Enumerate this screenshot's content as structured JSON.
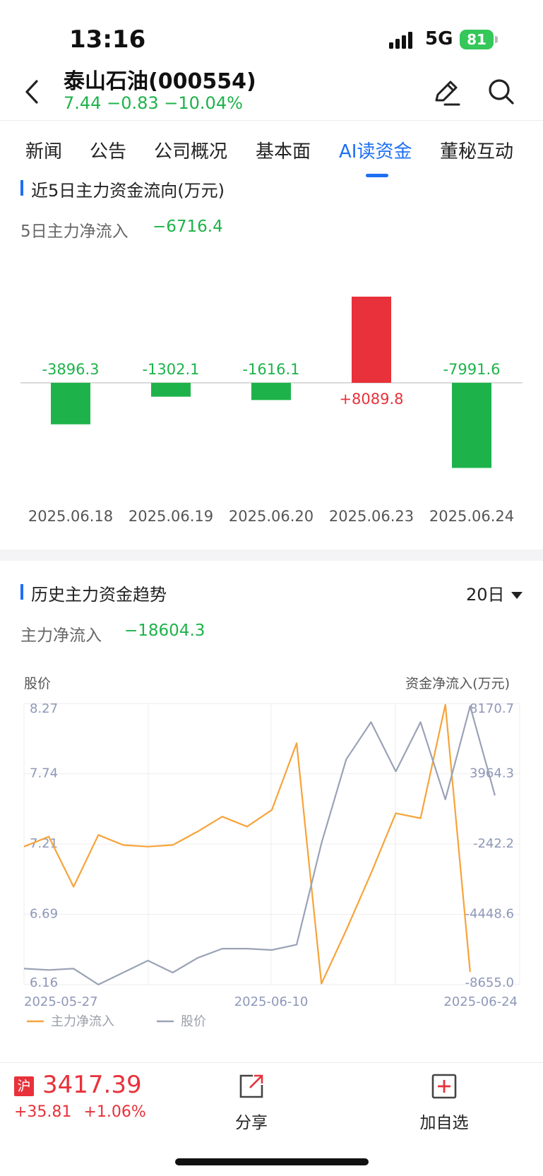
{
  "status_bar": {
    "time": "13:16",
    "network": "5G",
    "battery": "81"
  },
  "header": {
    "title": "泰山石油(000554)",
    "price": "7.44",
    "change": "−0.83",
    "change_pct": "−10.04%"
  },
  "tabs": [
    {
      "label": "新闻"
    },
    {
      "label": "公告"
    },
    {
      "label": "公司概况"
    },
    {
      "label": "基本面"
    },
    {
      "label": "AI读资金",
      "active": true
    },
    {
      "label": "董秘互动"
    }
  ],
  "five_day": {
    "title": "近5日主力资金流向(万元)",
    "net_label": "5日主力净流入",
    "net_value": "−6716.4"
  },
  "history": {
    "title": "历史主力资金趋势",
    "range": "20日",
    "net_label": "主力净流入",
    "net_value": "−18604.3",
    "left_axis_title": "股价",
    "right_axis_title": "资金净流入(万元)"
  },
  "chart_data": [
    {
      "type": "bar",
      "categories": [
        "2025.06.18",
        "2025.06.19",
        "2025.06.20",
        "2025.06.23",
        "2025.06.24"
      ],
      "values": [
        -3896.3,
        -1302.1,
        -1616.1,
        8089.8,
        -7991.6
      ],
      "labels": [
        "-3896.3",
        "-1302.1",
        "-1616.1",
        "+8089.8",
        "-7991.6"
      ],
      "colors": {
        "positive": "#e8313a",
        "negative": "#1db34a"
      }
    },
    {
      "type": "line",
      "x": [
        "2025-05-27",
        "2025-05-28",
        "2025-05-29",
        "2025-05-30",
        "2025-06-03",
        "2025-06-04",
        "2025-06-05",
        "2025-06-06",
        "2025-06-09",
        "2025-06-10",
        "2025-06-11",
        "2025-06-12",
        "2025-06-13",
        "2025-06-16",
        "2025-06-17",
        "2025-06-18",
        "2025-06-19",
        "2025-06-20",
        "2025-06-23",
        "2025-06-24",
        "2025-06-25"
      ],
      "x_ticks": [
        "2025-05-27",
        "2025-06-10",
        "2025-06-24"
      ],
      "left_ticks": [
        "8.27",
        "7.74",
        "7.21",
        "6.69",
        "6.16"
      ],
      "right_ticks": [
        "8170.7",
        "3964.3",
        "-242.2",
        "-4448.6",
        "-8655.0"
      ],
      "left_ylim": [
        6.16,
        8.27
      ],
      "right_ylim": [
        -8655.0,
        8170.7
      ],
      "series": [
        {
          "name": "主力净流入",
          "axis": "right",
          "color": "#f7a33a",
          "values": [
            -400,
            200,
            -2800,
            300,
            -300,
            -400,
            -300,
            500,
            1400,
            800,
            1800,
            5800,
            -8600,
            -5400,
            -2000,
            1600,
            1300,
            8100,
            -7900,
            null,
            null
          ]
        },
        {
          "name": "股价",
          "axis": "left",
          "color": "#9aa2b6",
          "values": [
            6.28,
            6.27,
            6.28,
            6.16,
            6.25,
            6.34,
            6.25,
            6.36,
            6.43,
            6.43,
            6.42,
            6.46,
            7.22,
            7.85,
            8.13,
            7.76,
            8.13,
            7.55,
            8.25,
            7.58,
            null
          ]
        }
      ]
    }
  ],
  "bottom_bar": {
    "index_badge": "沪",
    "index_value": "3417.39",
    "index_change": "+35.81",
    "index_change_pct": "+1.06%",
    "share_label": "分享",
    "watchlist_label": "加自选"
  }
}
